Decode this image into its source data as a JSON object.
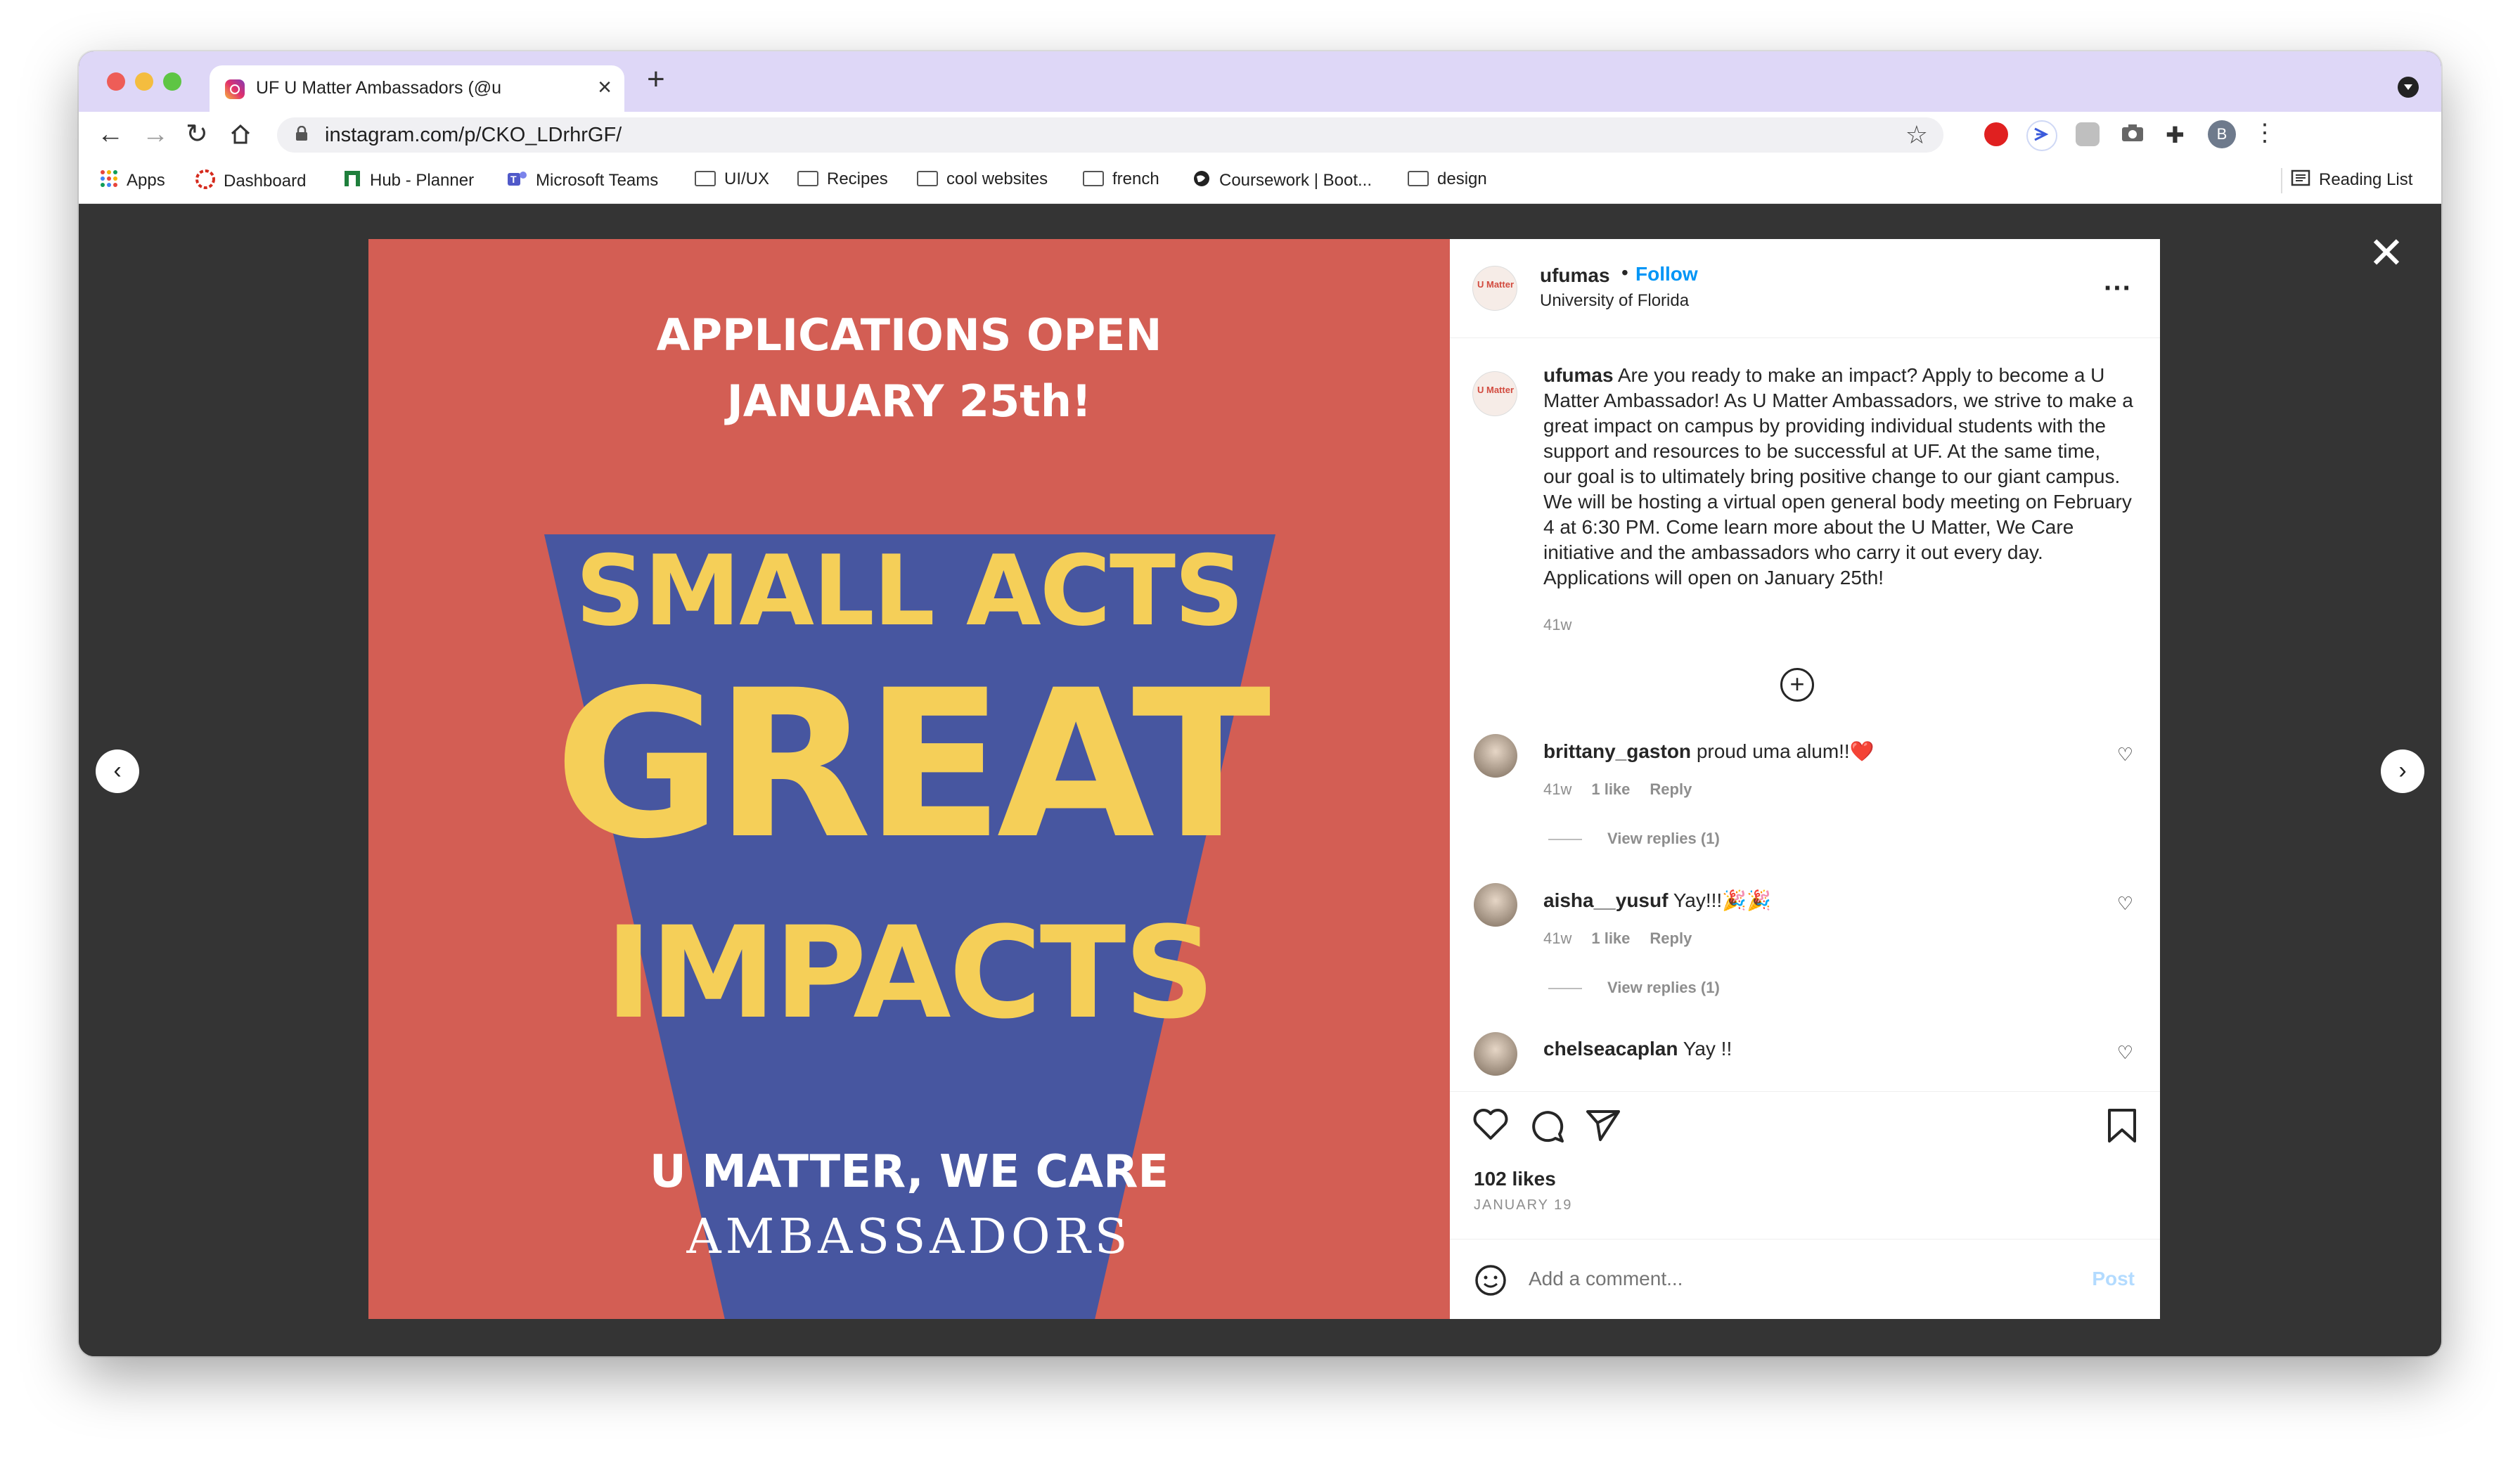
{
  "browser": {
    "tab_title": "UF U Matter Ambassadors (@u",
    "url": "instagram.com/p/CKO_LDrhrGF/",
    "profile_initial": "B",
    "bookmarks": [
      {
        "label": "Apps",
        "icon": "apps-grid-icon"
      },
      {
        "label": "Dashboard",
        "icon": "canvas-icon"
      },
      {
        "label": "Hub - Planner",
        "icon": "planner-icon"
      },
      {
        "label": "Microsoft Teams",
        "icon": "teams-icon"
      },
      {
        "label": "UI/UX",
        "icon": "folder-icon"
      },
      {
        "label": "Recipes",
        "icon": "folder-icon"
      },
      {
        "label": "cool websites",
        "icon": "folder-icon"
      },
      {
        "label": "french",
        "icon": "folder-icon"
      },
      {
        "label": "Coursework | Boot...",
        "icon": "globe-icon"
      },
      {
        "label": "design",
        "icon": "folder-icon"
      }
    ],
    "reading_list": "Reading List"
  },
  "post": {
    "image_text": {
      "open_line1": "APPLICATIONS OPEN",
      "open_line2": "JANUARY 25th!",
      "small_acts": "SMALL ACTS",
      "great": "GREAT",
      "impacts": "IMPACTS",
      "umatter": "U MATTER, WE CARE",
      "ambassadors": "AMBASSADORS"
    },
    "colors": {
      "red": "#d35e54",
      "blue": "#4756a0",
      "yellow": "#f5cf58"
    },
    "header": {
      "username": "ufumas",
      "follow": "Follow",
      "location": "University of Florida",
      "avatar_logo": "U Matter"
    },
    "caption": {
      "username": "ufumas",
      "text": "Are you ready to make an impact? Apply to become a U Matter Ambassador! As U Matter Ambassadors, we strive to make a great impact on campus by providing individual students with the support and resources to be successful at UF. At the same time, our goal is to ultimately bring positive change to our giant campus. We will be hosting a virtual open general body meeting on February 4 at 6:30 PM. Come learn more about the U Matter, We Care initiative and the ambassadors who carry it out every day. Applications will open on January 25th!",
      "time": "41w"
    },
    "comments": [
      {
        "username": "brittany_gaston",
        "text": "proud uma alum!!❤️",
        "time": "41w",
        "likes": "1 like",
        "reply": "Reply",
        "view_replies": "View replies (1)"
      },
      {
        "username": "aisha__yusuf",
        "text": "Yay!!!🎉🎉",
        "time": "41w",
        "likes": "1 like",
        "reply": "Reply",
        "view_replies": "View replies (1)"
      },
      {
        "username": "chelseacaplan",
        "text": "Yay !!"
      }
    ],
    "likes": "102 likes",
    "date": "JANUARY 19",
    "comment_placeholder": "Add a comment...",
    "post_button": "Post"
  }
}
